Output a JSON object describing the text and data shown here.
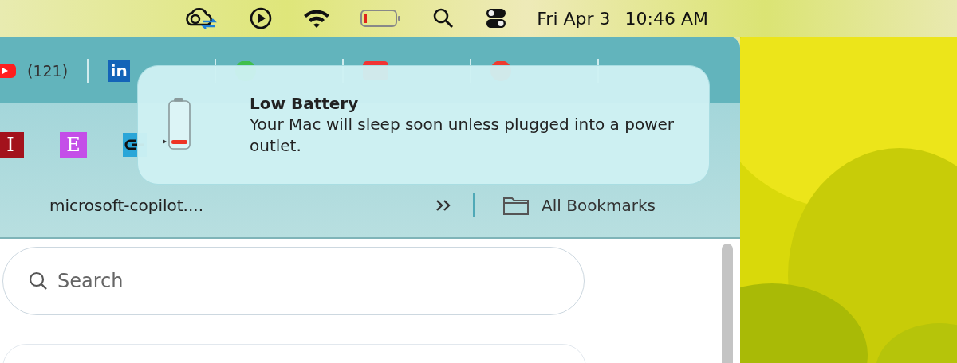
{
  "menu_bar": {
    "date": "Fri Apr 3",
    "time": "10:46 AM"
  },
  "tab_strip": [
    {
      "kind": "youtube",
      "label": "(121)"
    },
    {
      "kind": "linkedin",
      "logo": "in"
    },
    {
      "kind": "green"
    },
    {
      "kind": "red"
    },
    {
      "kind": "redcircle"
    }
  ],
  "favicons": [
    {
      "kind": "letter",
      "letter": "I",
      "color": "#a3121c"
    },
    {
      "kind": "letter",
      "letter": "E",
      "color": "#c44ee8"
    },
    {
      "kind": "link",
      "color": "#2aa6d8"
    }
  ],
  "bookmarks_bar": {
    "item": "microsoft-copilot....",
    "all_bookmarks": "All Bookmarks"
  },
  "notification": {
    "title": "Low Battery",
    "body": "Your Mac will sleep soon unless plugged into a power outlet."
  },
  "search": {
    "placeholder": "Search"
  }
}
